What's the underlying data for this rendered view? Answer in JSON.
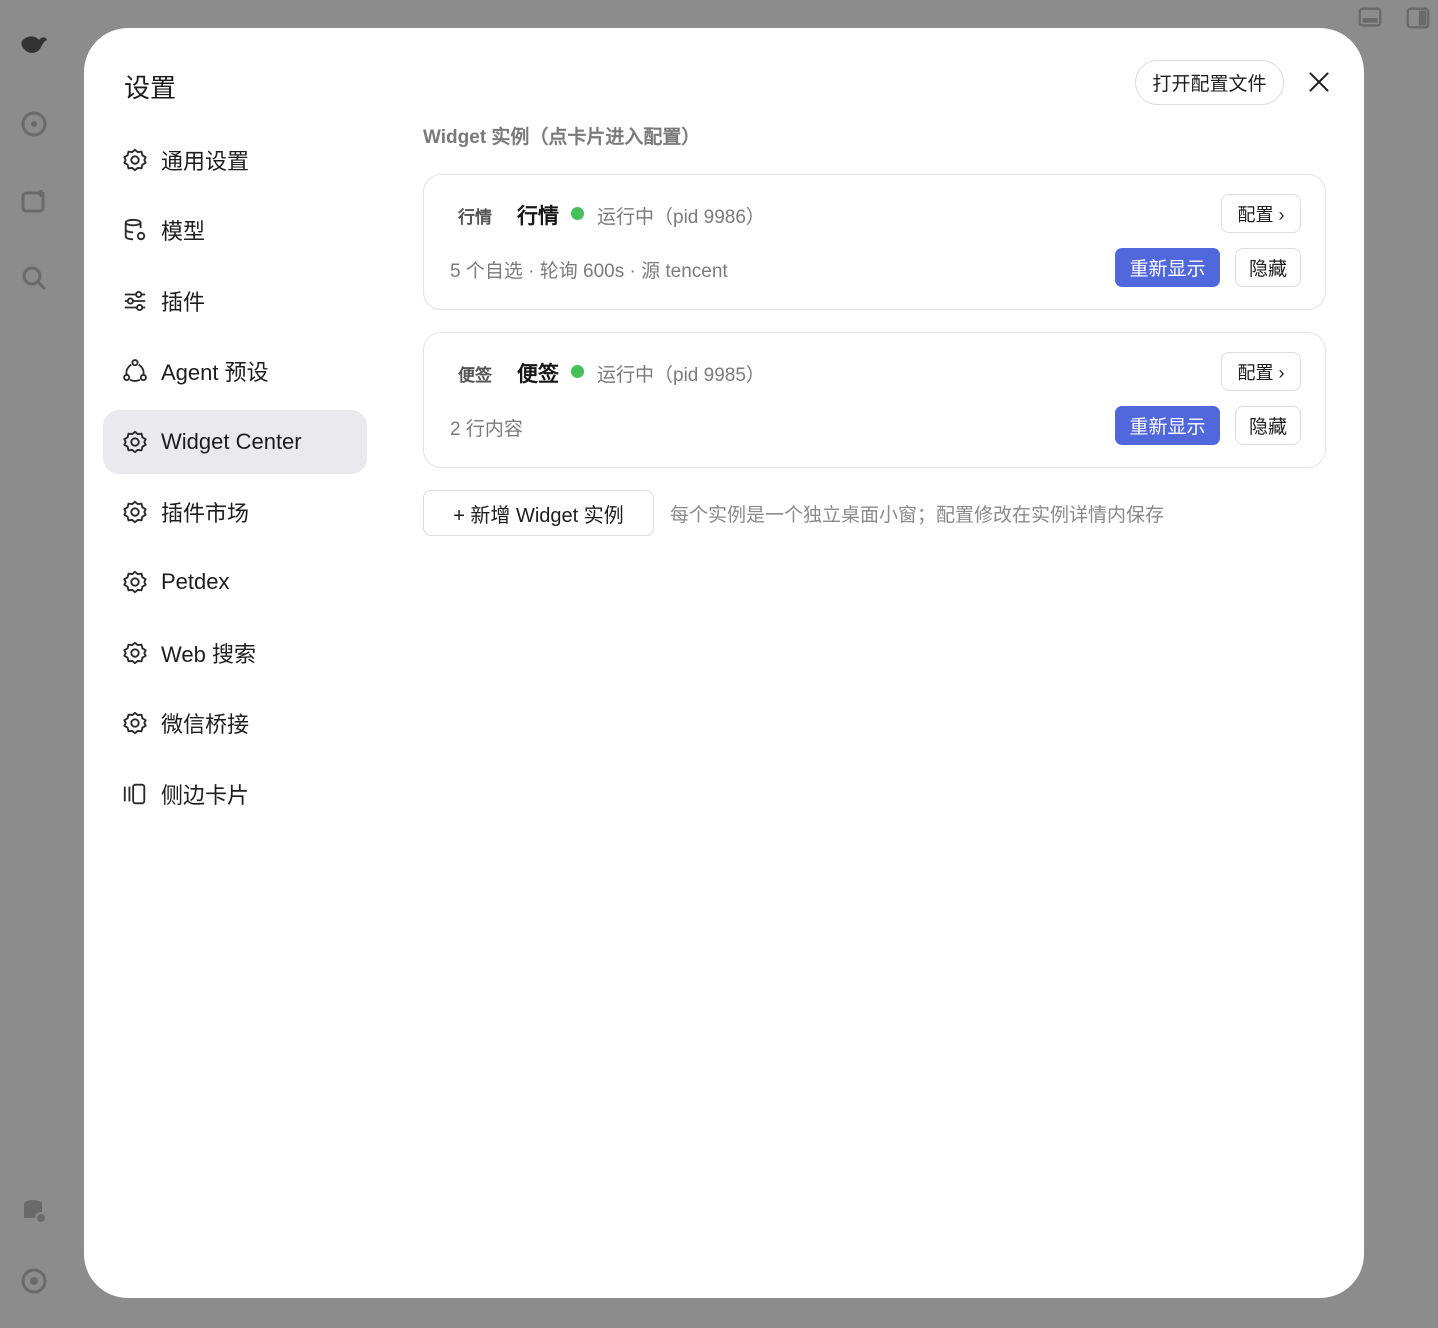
{
  "modal": {
    "title": "设置",
    "open_config_label": "打开配置文件"
  },
  "nav": {
    "items": [
      {
        "label": "通用设置",
        "icon": "gear-icon"
      },
      {
        "label": "模型",
        "icon": "database-gear-icon"
      },
      {
        "label": "插件",
        "icon": "sliders-icon"
      },
      {
        "label": "Agent 预设",
        "icon": "agent-cycle-icon"
      },
      {
        "label": "Widget Center",
        "icon": "gear-icon",
        "active": true
      },
      {
        "label": "插件市场",
        "icon": "gear-icon"
      },
      {
        "label": "Petdex",
        "icon": "gear-icon"
      },
      {
        "label": "Web 搜索",
        "icon": "gear-icon"
      },
      {
        "label": "微信桥接",
        "icon": "gear-icon"
      },
      {
        "label": "侧边卡片",
        "icon": "side-cards-icon"
      }
    ]
  },
  "content": {
    "section_title": "Widget 实例（点卡片进入配置）",
    "cards": [
      {
        "tag": "行情",
        "name": "行情",
        "status": "运行中（pid 9986）",
        "desc": "5 个自选 · 轮询 600s · 源 tencent",
        "config_label": "配置 ›",
        "reshow_label": "重新显示",
        "hide_label": "隐藏"
      },
      {
        "tag": "便签",
        "name": "便签",
        "status": "运行中（pid 9985）",
        "desc": "2 行内容",
        "config_label": "配置 ›",
        "reshow_label": "重新显示",
        "hide_label": "隐藏"
      }
    ],
    "add_label": "+ 新增 Widget 实例",
    "add_hint": "每个实例是一个独立桌面小窗；配置修改在实例详情内保存"
  },
  "colors": {
    "accent": "#5167dc",
    "status_running": "#46c05a",
    "active_nav_bg": "#e9e9ee"
  }
}
